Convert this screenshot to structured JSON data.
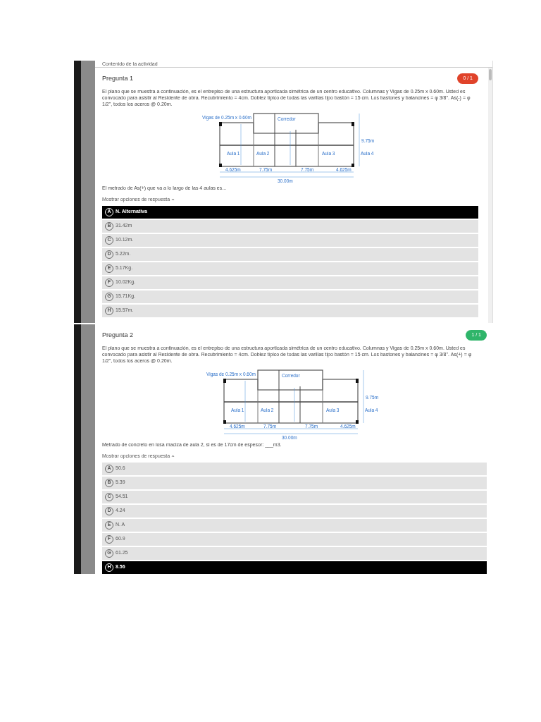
{
  "activity_header": "Contenido de la actividad",
  "questions": [
    {
      "title": "Pregunta 1",
      "score": "0 / 1",
      "correct": false,
      "statement": "El plano que se muestra a continuación, es el entrepiso de una estructura aporticada simétrica de un centro educativo. Columnas y Vigas de 0.25m x 0.60m. Usted es convocado para asistir al Residente de obra. Recubrimiento = 4cm. Doblez típico de todas las varillas tipo bastón = 15 cm. Los bastones y balancines = φ 3/8\". As(-) = φ 1/2\", todos los aceros @ 0.20m.",
      "plan": {
        "beam_note": "Vigas de 0.25m x 0.60m",
        "corridor": "Corredor",
        "rooms": [
          "Aula 1",
          "Aula 2",
          "Aula 3",
          "Aula 4"
        ],
        "spans": [
          "4.625m",
          "7.75m",
          "7.75m",
          "4.625m"
        ],
        "total": "30.00m",
        "height": "9.75m"
      },
      "prompt": "El metrado de As(+) que va a lo largo de las 4 aulas es...",
      "toggle": "Mostrar opciones de respuesta",
      "options": [
        {
          "letter": "A",
          "text": "N. Alternativa",
          "selected": true
        },
        {
          "letter": "B",
          "text": "31.42m",
          "selected": false
        },
        {
          "letter": "C",
          "text": "10.12m.",
          "selected": false
        },
        {
          "letter": "D",
          "text": "5.22m.",
          "selected": false
        },
        {
          "letter": "E",
          "text": "5.17Kg.",
          "selected": false
        },
        {
          "letter": "F",
          "text": "10.02Kg.",
          "selected": false
        },
        {
          "letter": "G",
          "text": "15.71Kg.",
          "selected": false
        },
        {
          "letter": "H",
          "text": "15.57m.",
          "selected": false
        }
      ]
    },
    {
      "title": "Pregunta 2",
      "score": "1 / 1",
      "correct": true,
      "statement": "El plano que se muestra a continuación, es el entrepiso de una estructura aporticada simétrica de un centro educativo. Columnas y Vigas de 0.25m x 0.60m. Usted es convocado para asistir al Residente de obra. Recubrimiento = 4cm. Doblez típico de todas las varillas tipo bastón = 15 cm. Los bastones y balancines = φ 3/8\". As(+) = φ 1/2\", todos los aceros @ 0.20m.",
      "plan": {
        "beam_note": "Vigas de 0.25m x 0.60m",
        "corridor": "Corredor",
        "rooms": [
          "Aula 1",
          "Aula 2",
          "Aula 3",
          "Aula 4"
        ],
        "spans": [
          "4.625m",
          "7.75m",
          "7.75m",
          "4.625m"
        ],
        "total": "30.00m",
        "height": "9.75m"
      },
      "prompt": "Metrado de concreto en losa maciza de aula 2, si es de 17cm de espesor: ___m3.",
      "toggle": "Mostrar opciones de respuesta",
      "options": [
        {
          "letter": "A",
          "text": "50.6",
          "selected": false
        },
        {
          "letter": "B",
          "text": "5.39",
          "selected": false
        },
        {
          "letter": "C",
          "text": "54.51",
          "selected": false
        },
        {
          "letter": "D",
          "text": "4.24",
          "selected": false
        },
        {
          "letter": "E",
          "text": "N. A",
          "selected": false
        },
        {
          "letter": "F",
          "text": "60.9",
          "selected": false
        },
        {
          "letter": "G",
          "text": "61.25",
          "selected": false
        },
        {
          "letter": "H",
          "text": "8.56",
          "selected": true
        }
      ]
    }
  ]
}
